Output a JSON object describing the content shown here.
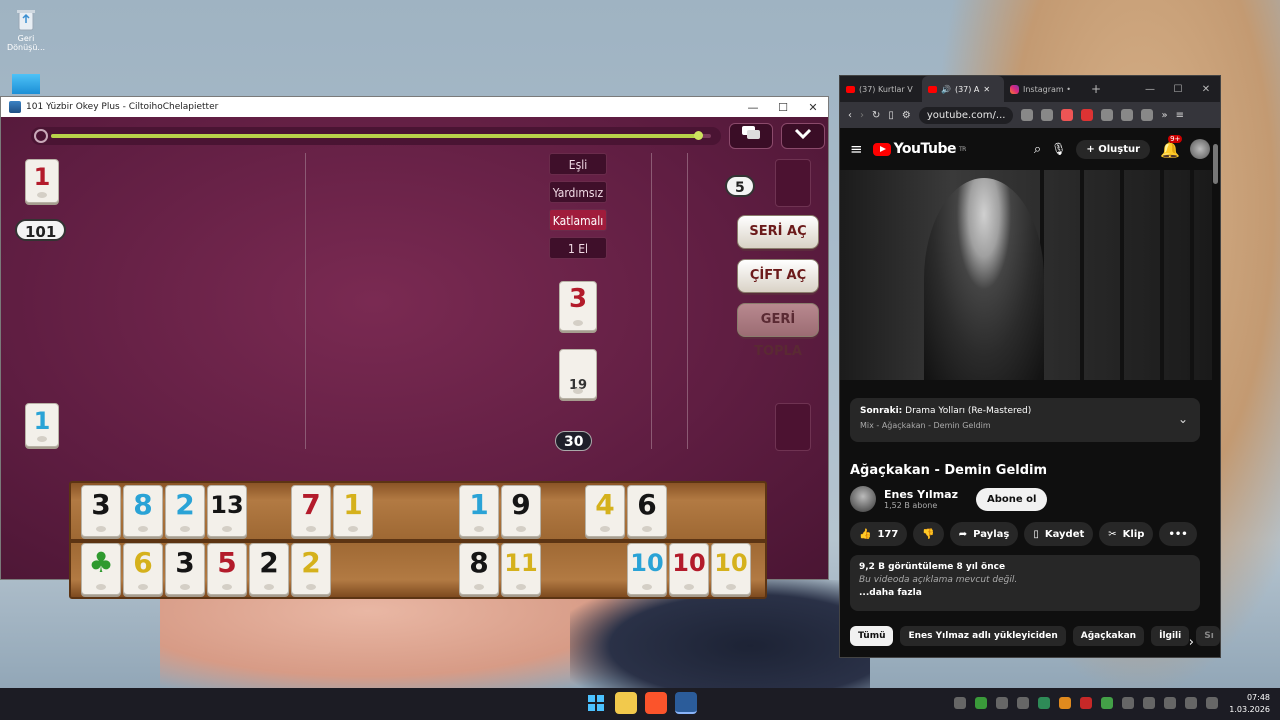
{
  "desktop": {
    "recycle_bin_label": "Geri Dönüşü..."
  },
  "game_window": {
    "title": "101 Yüzbir Okey Plus - CiltoihoChelapietter",
    "minimize": "—",
    "maximize": "☐",
    "close": "✕",
    "timer_progress": 0.98,
    "chat_icon": "chat-bubbles-icon",
    "menu_icon": "chevron-down-icon",
    "player_score": "101",
    "left_top_tile": "1",
    "left_top_tile_color": "red",
    "left_bottom_tile": "1",
    "left_bottom_tile_color": "blue",
    "opponent_count": "5",
    "center_top_tile": "3",
    "center_bottom_tile": "19",
    "deck_remaining": "30",
    "modes": [
      "Eşli",
      "Yardımsız",
      "Katlamalı",
      "1 El"
    ],
    "active_mode": "Katlamalı",
    "actions": {
      "seri": "SERİ AÇ",
      "cift": "ÇİFT AÇ",
      "geri": "GERİ TOPLA"
    },
    "rack_top": [
      {
        "v": "3",
        "c": "black"
      },
      {
        "v": "8",
        "c": "blue"
      },
      {
        "v": "2",
        "c": "blue"
      },
      {
        "v": "13",
        "c": "black"
      },
      {
        "v": "7",
        "c": "red"
      },
      {
        "v": "1",
        "c": "yellow"
      },
      {
        "v": "1",
        "c": "blue"
      },
      {
        "v": "9",
        "c": "black"
      },
      {
        "v": "4",
        "c": "yellow"
      },
      {
        "v": "6",
        "c": "black"
      }
    ],
    "rack_bottom": [
      {
        "v": "♣",
        "c": "green"
      },
      {
        "v": "6",
        "c": "yellow"
      },
      {
        "v": "3",
        "c": "black"
      },
      {
        "v": "5",
        "c": "red"
      },
      {
        "v": "2",
        "c": "black"
      },
      {
        "v": "2",
        "c": "yellow"
      },
      {
        "v": "8",
        "c": "black"
      },
      {
        "v": "11",
        "c": "yellow"
      },
      {
        "v": "10",
        "c": "blue"
      },
      {
        "v": "10",
        "c": "red"
      },
      {
        "v": "10",
        "c": "yellow"
      }
    ]
  },
  "browser": {
    "tabs": [
      {
        "label": "(37) Kurtlar V",
        "icon": "youtube-icon"
      },
      {
        "label": "(37) A",
        "icon": "youtube-icon",
        "active": true
      },
      {
        "label": "Instagram •",
        "icon": "instagram-icon"
      }
    ],
    "new_tab": "+",
    "url": "youtube.com/...",
    "youtube": {
      "logo": "YouTube",
      "region": "TR",
      "create_label": "Oluştur",
      "notifications": "9+",
      "up_next_prefix": "Sonraki:",
      "up_next_title": "Drama Yolları (Re-Mastered)",
      "up_next_sub": "Mix - Ağaçkakan - Demin Geldim",
      "video_title": "Ağaçkakan - Demin Geldim",
      "channel_name": "Enes Yılmaz",
      "channel_subs": "1,52 B abone",
      "subscribe_label": "Abone ol",
      "likes": "177",
      "share_label": "Paylaş",
      "save_label": "Kaydet",
      "clip_label": "Klip",
      "more_label": "•••",
      "views_age": "9,2 B görüntüleme  8 yıl önce",
      "no_description": "Bu videoda açıklama mevcut değil.",
      "show_more": "...daha fazla",
      "chips": [
        "Tümü",
        "Enes Yılmaz adlı yükleyiciden",
        "Ağaçkakan",
        "İlgili",
        "Sı"
      ]
    }
  },
  "taskbar": {
    "time": "07:48",
    "date": "1.03.2026"
  }
}
